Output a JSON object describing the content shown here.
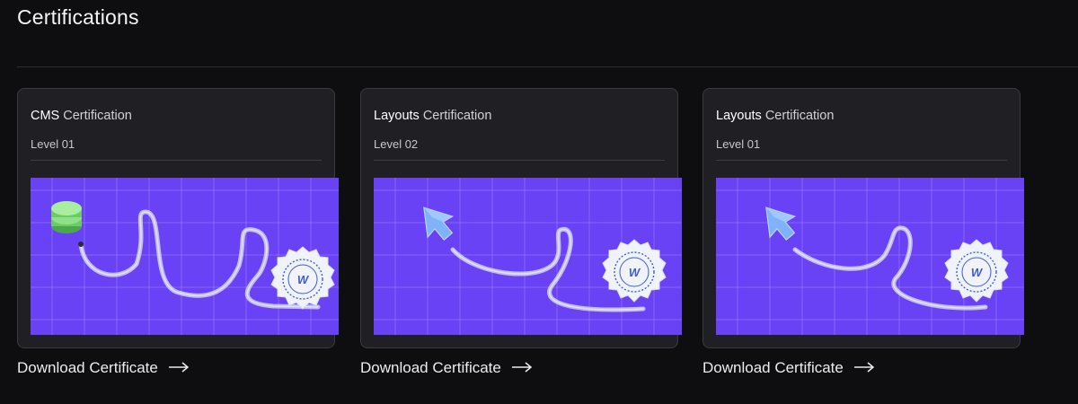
{
  "page": {
    "title": "Certifications"
  },
  "cards": [
    {
      "title_strong": "CMS",
      "title_rest": " Certification",
      "level": "Level 01",
      "badge_letter": "W",
      "object_icon": "database-stack-icon",
      "download_label": "Download Certificate"
    },
    {
      "title_strong": "Layouts",
      "title_rest": " Certification",
      "level": "Level 02",
      "badge_letter": "W",
      "object_icon": "cursor-arrow-icon",
      "download_label": "Download Certificate"
    },
    {
      "title_strong": "Layouts",
      "title_rest": " Certification",
      "level": "Level 01",
      "badge_letter": "W",
      "object_icon": "cursor-arrow-icon",
      "download_label": "Download Certificate"
    }
  ],
  "colors": {
    "background": "#0e0e10",
    "card": "#202024",
    "art_purple": "#6a42f5",
    "grid_line": "#9a86ff",
    "badge": "#eef0fb",
    "badge_accent": "#3d5bd6",
    "db_green": "#7fd77a",
    "cursor_blue": "#6ea8f7"
  }
}
